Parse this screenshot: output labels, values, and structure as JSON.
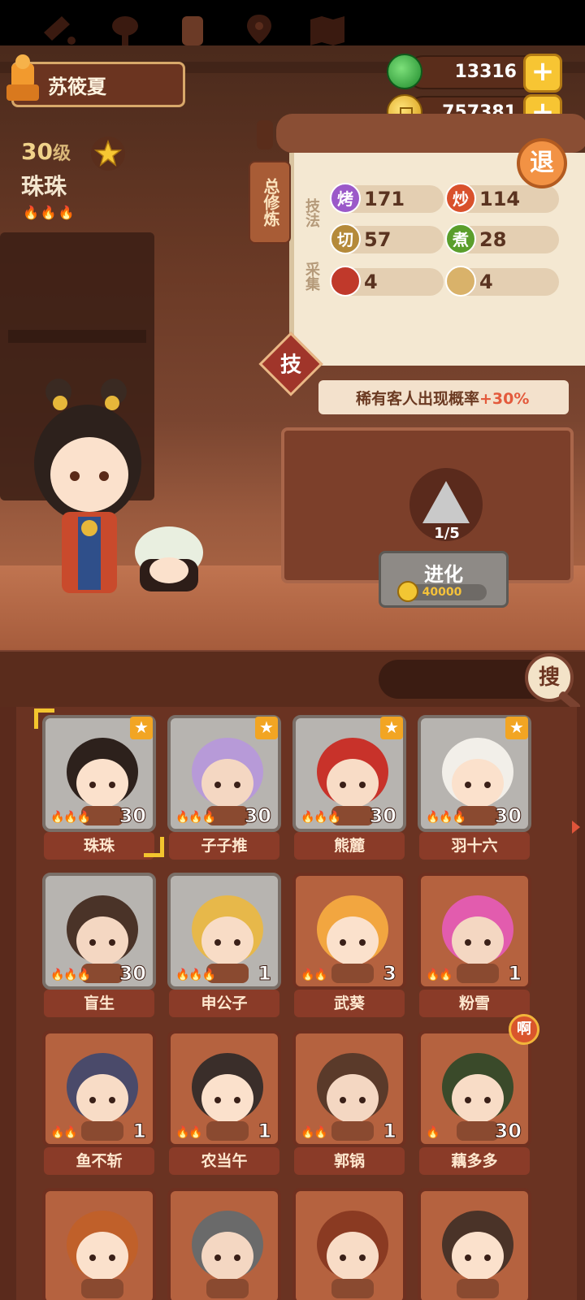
{
  "player": {
    "name": "苏筱夏"
  },
  "currency": {
    "jade": "13316",
    "coins": "757381",
    "plus": "+"
  },
  "selected_character": {
    "level": "30",
    "level_unit": "级",
    "name": "珠珠",
    "stars": 3
  },
  "panel": {
    "tab_label": "总修炼",
    "technique_label": "技法",
    "gather_label": "采集",
    "exit_label": "退",
    "skills": [
      {
        "icon": "烤",
        "value": "171",
        "color": "#9b59c9"
      },
      {
        "icon": "炒",
        "value": "114",
        "color": "#d9512c"
      },
      {
        "icon": "切",
        "value": "57",
        "color": "#b58a3a"
      },
      {
        "icon": "煮",
        "value": "28",
        "color": "#5a9e2c"
      }
    ],
    "gathers": [
      {
        "icon": "meat-icon",
        "value": "4",
        "color": "#c0392b"
      },
      {
        "icon": "bun-icon",
        "value": "4",
        "color": "#d9b26a"
      }
    ],
    "skill_button": "技",
    "bonus": {
      "text": "稀有客人出现概率",
      "value": "+30%"
    },
    "evolve": {
      "progress": "1/5",
      "label": "进化",
      "cost": "40000"
    }
  },
  "filters": [
    "meat-filter-icon",
    "vegetable-filter-icon",
    "jar-filter-icon",
    "location-filter-icon",
    "map-hint-filter-icon"
  ],
  "search": {
    "button": "搜",
    "placeholder": ""
  },
  "roster": [
    {
      "name": "珠珠",
      "level": "30",
      "flames": "🔥🔥🔥",
      "rare": true,
      "star": true,
      "selected": true
    },
    {
      "name": "子子推",
      "level": "30",
      "flames": "🔥🔥🔥",
      "rare": true,
      "star": true
    },
    {
      "name": "熊麓",
      "level": "30",
      "flames": "🔥🔥🔥",
      "rare": true,
      "star": true
    },
    {
      "name": "羽十六",
      "level": "30",
      "flames": "🔥🔥🔥",
      "rare": true,
      "star": true
    },
    {
      "name": "盲生",
      "level": "30",
      "flames": "🔥🔥🔥",
      "rare": true
    },
    {
      "name": "申公子",
      "level": "1",
      "flames": "🔥🔥🔥",
      "rare": true
    },
    {
      "name": "武葵",
      "level": "3",
      "flames": "🔥🔥",
      "rare": false
    },
    {
      "name": "粉雪",
      "level": "1",
      "flames": "🔥🔥",
      "rare": false
    },
    {
      "name": "鱼不斩",
      "level": "1",
      "flames": "🔥🔥",
      "rare": false
    },
    {
      "name": "农当午",
      "level": "1",
      "flames": "🔥🔥",
      "rare": false
    },
    {
      "name": "郭锅",
      "level": "1",
      "flames": "🔥🔥",
      "rare": false
    },
    {
      "name": "藕多多",
      "level": "30",
      "flames": "🔥",
      "rare": false,
      "badge": "啊"
    },
    {
      "name": "",
      "level": "",
      "flames": "",
      "rare": false
    },
    {
      "name": "",
      "level": "",
      "flames": "",
      "rare": false
    },
    {
      "name": "",
      "level": "",
      "flames": "",
      "rare": false
    },
    {
      "name": "",
      "level": "",
      "flames": "",
      "rare": false
    }
  ]
}
